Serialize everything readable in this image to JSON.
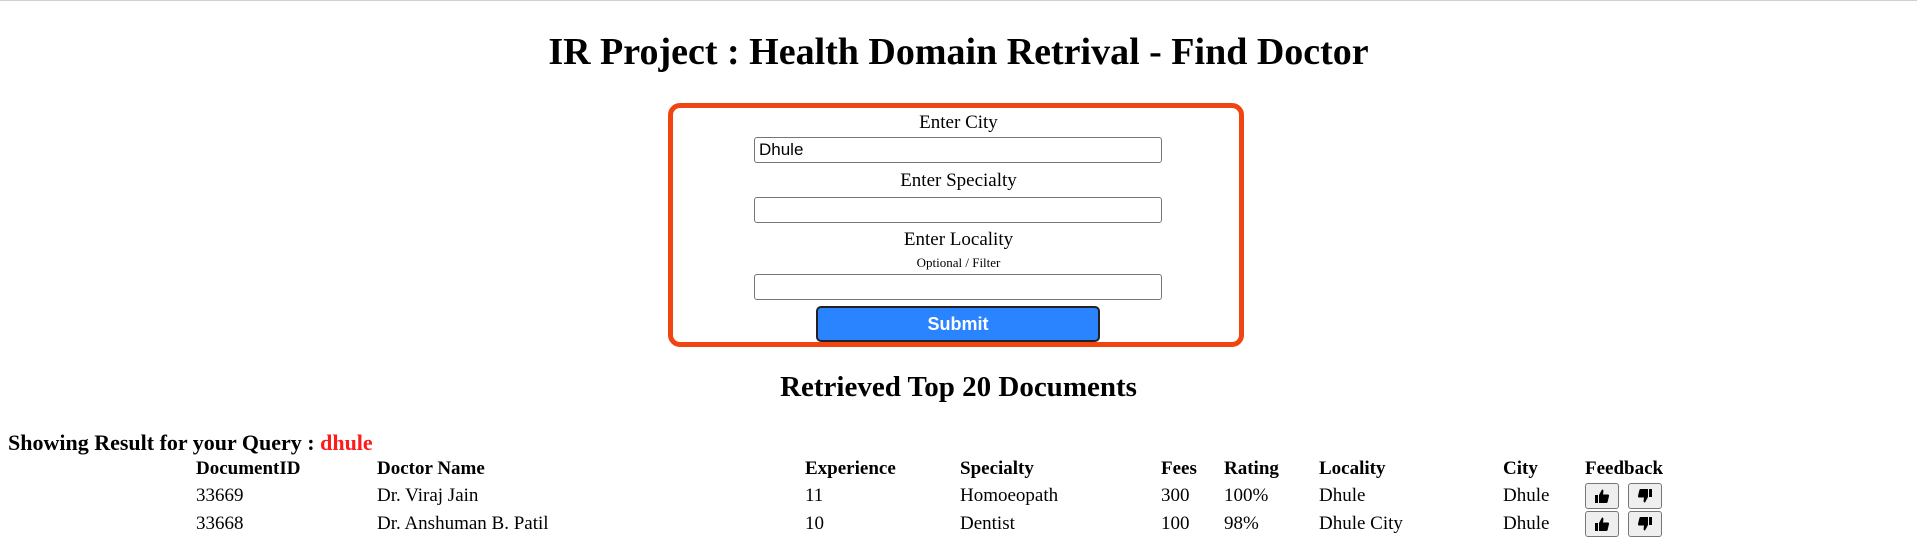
{
  "page": {
    "title": "IR Project : Health Domain Retrival - Find Doctor"
  },
  "form": {
    "city_label": "Enter City",
    "city_value": "Dhule",
    "specialty_label": "Enter Specialty",
    "specialty_value": "",
    "locality_label": "Enter Locality",
    "locality_hint": "Optional / Filter",
    "locality_value": "",
    "submit_label": "Submit",
    "accent_color": "#f04411",
    "submit_color": "#2a84ff"
  },
  "results": {
    "heading": "Retrieved Top 20 Documents",
    "query_prefix": "Showing Result for your Query :",
    "query": "dhule",
    "columns": {
      "id": "DocumentID",
      "name": "Doctor Name",
      "experience": "Experience",
      "specialty": "Specialty",
      "fees": "Fees",
      "rating": "Rating",
      "locality": "Locality",
      "city": "City",
      "feedback": "Feedback"
    },
    "rows": [
      {
        "id": "33669",
        "name": "Dr. Viraj Jain",
        "experience": "11",
        "specialty": "Homoeopath",
        "fees": "300",
        "rating": "100%",
        "locality": "Dhule",
        "city": "Dhule"
      },
      {
        "id": "33668",
        "name": "Dr. Anshuman B. Patil",
        "experience": "10",
        "specialty": "Dentist",
        "fees": "100",
        "rating": "98%",
        "locality": "Dhule City",
        "city": "Dhule"
      }
    ],
    "feedback_icons": [
      "thumbs-up-icon",
      "thumbs-down-icon"
    ]
  }
}
